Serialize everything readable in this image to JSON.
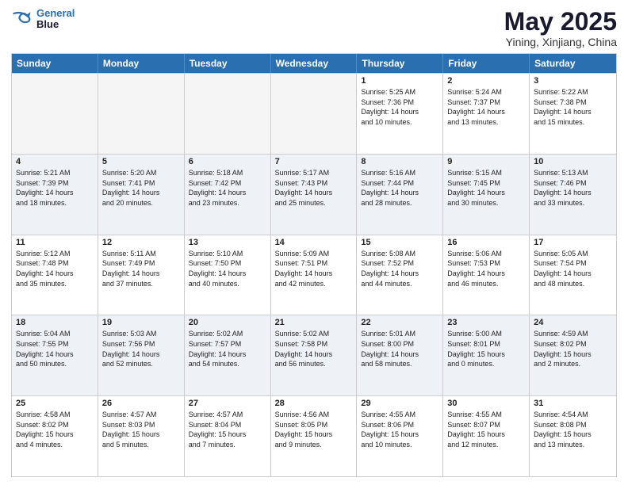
{
  "header": {
    "logo_line1": "General",
    "logo_line2": "Blue",
    "title": "May 2025",
    "subtitle": "Yining, Xinjiang, China"
  },
  "calendar": {
    "days": [
      "Sunday",
      "Monday",
      "Tuesday",
      "Wednesday",
      "Thursday",
      "Friday",
      "Saturday"
    ],
    "rows": [
      [
        {
          "num": "",
          "text": "",
          "empty": true
        },
        {
          "num": "",
          "text": "",
          "empty": true
        },
        {
          "num": "",
          "text": "",
          "empty": true
        },
        {
          "num": "",
          "text": "",
          "empty": true
        },
        {
          "num": "1",
          "text": "Sunrise: 5:25 AM\nSunset: 7:36 PM\nDaylight: 14 hours\nand 10 minutes.",
          "empty": false
        },
        {
          "num": "2",
          "text": "Sunrise: 5:24 AM\nSunset: 7:37 PM\nDaylight: 14 hours\nand 13 minutes.",
          "empty": false
        },
        {
          "num": "3",
          "text": "Sunrise: 5:22 AM\nSunset: 7:38 PM\nDaylight: 14 hours\nand 15 minutes.",
          "empty": false
        }
      ],
      [
        {
          "num": "4",
          "text": "Sunrise: 5:21 AM\nSunset: 7:39 PM\nDaylight: 14 hours\nand 18 minutes.",
          "empty": false
        },
        {
          "num": "5",
          "text": "Sunrise: 5:20 AM\nSunset: 7:41 PM\nDaylight: 14 hours\nand 20 minutes.",
          "empty": false
        },
        {
          "num": "6",
          "text": "Sunrise: 5:18 AM\nSunset: 7:42 PM\nDaylight: 14 hours\nand 23 minutes.",
          "empty": false
        },
        {
          "num": "7",
          "text": "Sunrise: 5:17 AM\nSunset: 7:43 PM\nDaylight: 14 hours\nand 25 minutes.",
          "empty": false
        },
        {
          "num": "8",
          "text": "Sunrise: 5:16 AM\nSunset: 7:44 PM\nDaylight: 14 hours\nand 28 minutes.",
          "empty": false
        },
        {
          "num": "9",
          "text": "Sunrise: 5:15 AM\nSunset: 7:45 PM\nDaylight: 14 hours\nand 30 minutes.",
          "empty": false
        },
        {
          "num": "10",
          "text": "Sunrise: 5:13 AM\nSunset: 7:46 PM\nDaylight: 14 hours\nand 33 minutes.",
          "empty": false
        }
      ],
      [
        {
          "num": "11",
          "text": "Sunrise: 5:12 AM\nSunset: 7:48 PM\nDaylight: 14 hours\nand 35 minutes.",
          "empty": false
        },
        {
          "num": "12",
          "text": "Sunrise: 5:11 AM\nSunset: 7:49 PM\nDaylight: 14 hours\nand 37 minutes.",
          "empty": false
        },
        {
          "num": "13",
          "text": "Sunrise: 5:10 AM\nSunset: 7:50 PM\nDaylight: 14 hours\nand 40 minutes.",
          "empty": false
        },
        {
          "num": "14",
          "text": "Sunrise: 5:09 AM\nSunset: 7:51 PM\nDaylight: 14 hours\nand 42 minutes.",
          "empty": false
        },
        {
          "num": "15",
          "text": "Sunrise: 5:08 AM\nSunset: 7:52 PM\nDaylight: 14 hours\nand 44 minutes.",
          "empty": false
        },
        {
          "num": "16",
          "text": "Sunrise: 5:06 AM\nSunset: 7:53 PM\nDaylight: 14 hours\nand 46 minutes.",
          "empty": false
        },
        {
          "num": "17",
          "text": "Sunrise: 5:05 AM\nSunset: 7:54 PM\nDaylight: 14 hours\nand 48 minutes.",
          "empty": false
        }
      ],
      [
        {
          "num": "18",
          "text": "Sunrise: 5:04 AM\nSunset: 7:55 PM\nDaylight: 14 hours\nand 50 minutes.",
          "empty": false
        },
        {
          "num": "19",
          "text": "Sunrise: 5:03 AM\nSunset: 7:56 PM\nDaylight: 14 hours\nand 52 minutes.",
          "empty": false
        },
        {
          "num": "20",
          "text": "Sunrise: 5:02 AM\nSunset: 7:57 PM\nDaylight: 14 hours\nand 54 minutes.",
          "empty": false
        },
        {
          "num": "21",
          "text": "Sunrise: 5:02 AM\nSunset: 7:58 PM\nDaylight: 14 hours\nand 56 minutes.",
          "empty": false
        },
        {
          "num": "22",
          "text": "Sunrise: 5:01 AM\nSunset: 8:00 PM\nDaylight: 14 hours\nand 58 minutes.",
          "empty": false
        },
        {
          "num": "23",
          "text": "Sunrise: 5:00 AM\nSunset: 8:01 PM\nDaylight: 15 hours\nand 0 minutes.",
          "empty": false
        },
        {
          "num": "24",
          "text": "Sunrise: 4:59 AM\nSunset: 8:02 PM\nDaylight: 15 hours\nand 2 minutes.",
          "empty": false
        }
      ],
      [
        {
          "num": "25",
          "text": "Sunrise: 4:58 AM\nSunset: 8:02 PM\nDaylight: 15 hours\nand 4 minutes.",
          "empty": false
        },
        {
          "num": "26",
          "text": "Sunrise: 4:57 AM\nSunset: 8:03 PM\nDaylight: 15 hours\nand 5 minutes.",
          "empty": false
        },
        {
          "num": "27",
          "text": "Sunrise: 4:57 AM\nSunset: 8:04 PM\nDaylight: 15 hours\nand 7 minutes.",
          "empty": false
        },
        {
          "num": "28",
          "text": "Sunrise: 4:56 AM\nSunset: 8:05 PM\nDaylight: 15 hours\nand 9 minutes.",
          "empty": false
        },
        {
          "num": "29",
          "text": "Sunrise: 4:55 AM\nSunset: 8:06 PM\nDaylight: 15 hours\nand 10 minutes.",
          "empty": false
        },
        {
          "num": "30",
          "text": "Sunrise: 4:55 AM\nSunset: 8:07 PM\nDaylight: 15 hours\nand 12 minutes.",
          "empty": false
        },
        {
          "num": "31",
          "text": "Sunrise: 4:54 AM\nSunset: 8:08 PM\nDaylight: 15 hours\nand 13 minutes.",
          "empty": false
        }
      ]
    ]
  }
}
